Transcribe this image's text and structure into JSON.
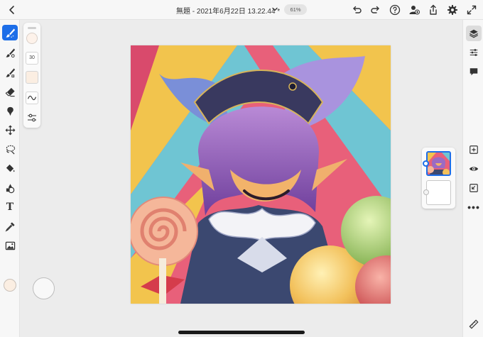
{
  "header": {
    "title": "無題 - 2021年6月22日 13.22.44 *",
    "zoom": "61%",
    "icons": [
      "back-chevron-icon",
      "dropdown-chevron-icon",
      "undo-icon",
      "redo-icon",
      "help-icon",
      "add-user-icon",
      "share-icon",
      "settings-gear-icon",
      "fullscreen-icon"
    ]
  },
  "left_toolbar": {
    "tools": [
      "pixel-brush-icon",
      "live-brush-icon",
      "vector-brush-icon",
      "eraser-icon",
      "smudge-icon",
      "transform-icon",
      "lasso-selection-icon",
      "fill-bucket-icon",
      "shape-icon",
      "type-icon",
      "eyedropper-icon",
      "image-icon"
    ],
    "active_tool": "pixel-brush-icon",
    "current_color": "#fbeee2"
  },
  "brush_panel": {
    "size": "30",
    "color": "#fdf2ea"
  },
  "right_toolbar": {
    "tools": [
      "layers-icon",
      "adjustments-icon",
      "comments-icon",
      "add-layer-icon",
      "visibility-eye-icon",
      "import-icon",
      "more-options-icon",
      "ruler-icon"
    ],
    "more_label": "•••"
  },
  "layers": {
    "count": 2,
    "active_index": 0
  },
  "colors": {
    "accent": "#1d6ee8",
    "toolbar_bg": "#f7f7f7",
    "workspace_bg": "#ececec"
  }
}
